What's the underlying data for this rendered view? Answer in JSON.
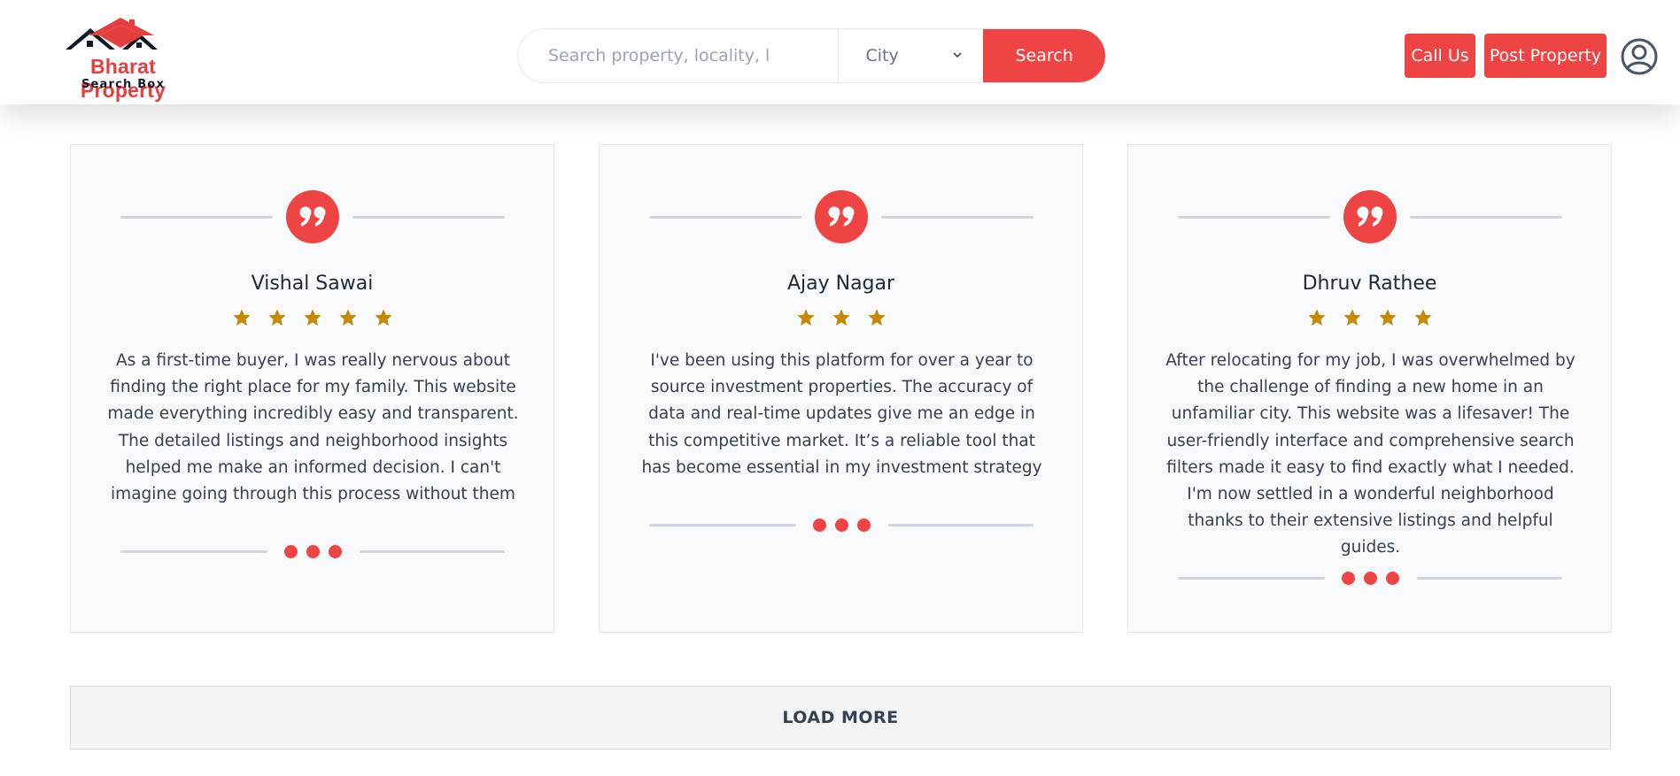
{
  "brand": {
    "title": "Bharat Property",
    "subtitle": "Search Box",
    "accent": "#ef4444"
  },
  "search": {
    "placeholder": "Search property, locality, l",
    "city_label": "City",
    "button_label": "Search"
  },
  "header_actions": {
    "call_label": "Call Us",
    "post_label": "Post Property"
  },
  "testimonials": [
    {
      "name": "Vishal Sawai",
      "rating": 5,
      "text": "As a first-time buyer, I was really nervous about finding the right place for my family. This website made everything incredibly easy and transparent. The detailed listings and neighborhood insights helped me make an informed decision. I can't imagine going through this process without them"
    },
    {
      "name": "Ajay Nagar",
      "rating": 3,
      "text": "I've been using this platform for over a year to source investment properties. The accuracy of data and real-time updates give me an edge in this competitive market. It’s a reliable tool that has become essential in my investment strategy"
    },
    {
      "name": "Dhruv Rathee",
      "rating": 4,
      "text": "After relocating for my job, I was overwhelmed by the challenge of finding a new home in an unfamiliar city. This website was a lifesaver! The user-friendly interface and comprehensive search filters made it easy to find exactly what I needed. I'm now settled in a wonderful neighborhood thanks to their extensive listings and helpful guides."
    }
  ],
  "load_more_label": "LOAD MORE",
  "colors": {
    "star": "#c48a06",
    "divider": "#cfd6e0",
    "card_bg": "#f8f9fb"
  }
}
